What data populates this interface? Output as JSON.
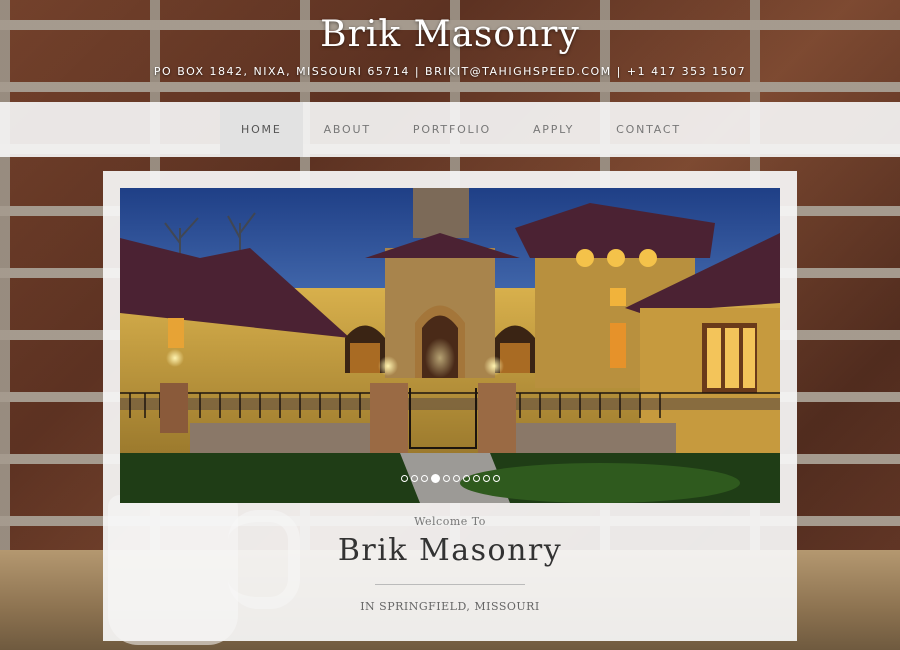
{
  "site": {
    "title": "Brik Masonry",
    "contact": "PO BOX 1842, NIXA, MISSOURI 65714 | BRIKIT@TAHIGHSPEED.COM | +1 417 353 1507"
  },
  "nav": {
    "items": [
      {
        "label": "HOME",
        "active": true
      },
      {
        "label": "ABOUT",
        "active": false
      },
      {
        "label": "PORTFOLIO",
        "active": false
      },
      {
        "label": "APPLY",
        "active": false
      },
      {
        "label": "CONTACT",
        "active": false
      }
    ]
  },
  "slider": {
    "image_icon": "house-photo",
    "slide_count": 10,
    "current_slide": 4
  },
  "hero": {
    "welcome": "Welcome To",
    "title": "Brik Masonry",
    "location": "IN SPRINGFIELD, MISSOURI"
  },
  "colors": {
    "nav_bg": "#f5f5f5",
    "nav_active_bg": "#e2e2e2",
    "panel_bg": "#f6f6f6",
    "title_color": "#333333"
  }
}
